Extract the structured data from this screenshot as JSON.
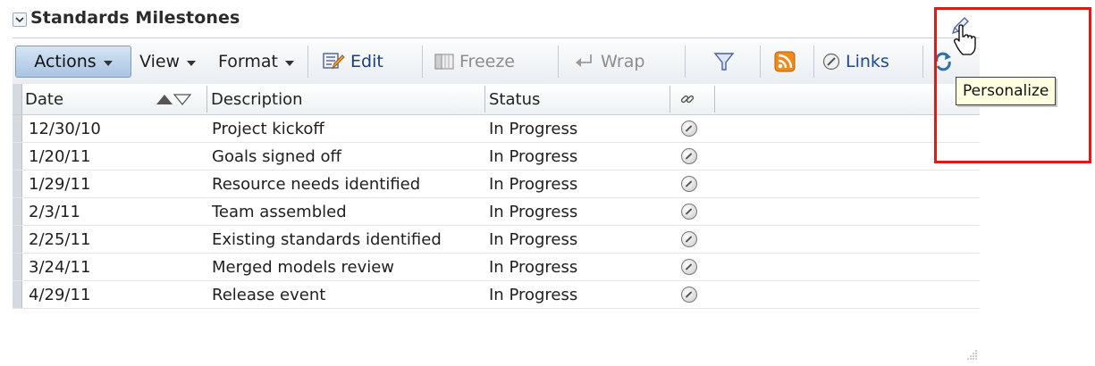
{
  "panel": {
    "title": "Standards Milestones"
  },
  "toolbar": {
    "actions_label": "Actions",
    "view_label": "View",
    "format_label": "Format",
    "edit_label": "Edit",
    "freeze_label": "Freeze",
    "wrap_label": "Wrap",
    "links_label": "Links"
  },
  "table": {
    "columns": [
      "Date",
      "Description",
      "Status"
    ],
    "rows": [
      {
        "date": "12/30/10",
        "description": "Project kickoff",
        "status": "In Progress"
      },
      {
        "date": "1/20/11",
        "description": "Goals signed off",
        "status": "In Progress"
      },
      {
        "date": "1/29/11",
        "description": "Resource needs identified",
        "status": "In Progress"
      },
      {
        "date": "2/3/11",
        "description": "Team assembled",
        "status": "In Progress"
      },
      {
        "date": "2/25/11",
        "description": "Existing standards identified",
        "status": "In Progress"
      },
      {
        "date": "3/24/11",
        "description": "Merged models review",
        "status": "In Progress"
      },
      {
        "date": "4/29/11",
        "description": "Release event",
        "status": "In Progress"
      }
    ]
  },
  "tooltip": {
    "text": "Personalize"
  },
  "colors": {
    "highlight": "#e01818",
    "accent": "#a9c4e2",
    "tooltip_bg": "#ffffe1"
  }
}
